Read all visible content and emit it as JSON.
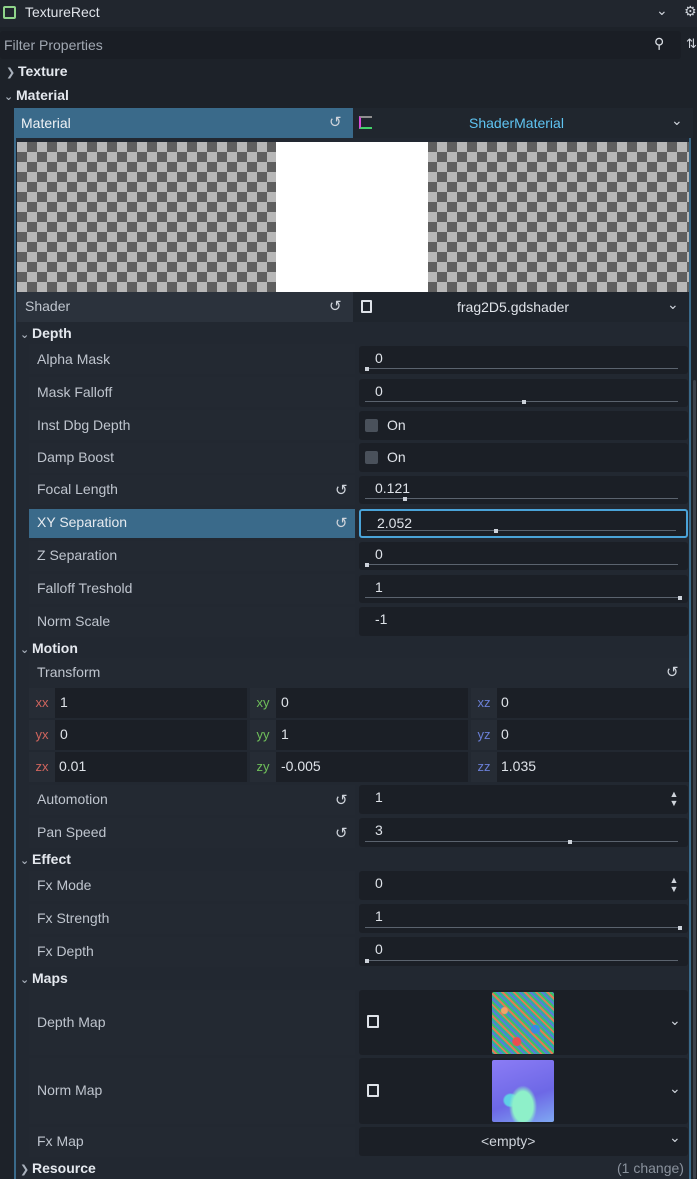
{
  "header": {
    "node_type": "TextureRect"
  },
  "filter": {
    "placeholder": "Filter Properties"
  },
  "sections": {
    "texture": "Texture",
    "material": "Material",
    "resource": "Resource",
    "resource_note": "(1 change)"
  },
  "material": {
    "label": "Material",
    "resource_type": "ShaderMaterial"
  },
  "shader": {
    "label": "Shader",
    "file": "frag2D5.gdshader"
  },
  "groups": {
    "depth": "Depth",
    "motion": "Motion",
    "effect": "Effect",
    "maps": "Maps"
  },
  "depth_props": [
    {
      "label": "Alpha Mask",
      "value": "0",
      "slider_fraction": 0.0
    },
    {
      "label": "Mask Falloff",
      "value": "0",
      "slider_fraction": 0.5
    },
    {
      "label": "Inst Dbg Depth",
      "check_label": "On"
    },
    {
      "label": "Damp Boost",
      "check_label": "On"
    },
    {
      "label": "Focal Length",
      "value": "0.121",
      "slider_fraction": 0.12
    },
    {
      "label": "XY Separation",
      "value": "2.052",
      "slider_fraction": 0.41
    },
    {
      "label": "Z Separation",
      "value": "0",
      "slider_fraction": 0.0
    },
    {
      "label": "Falloff Treshold",
      "value": "1",
      "slider_fraction": 1.0
    },
    {
      "label": "Norm Scale",
      "value": "-1"
    }
  ],
  "transform": {
    "label": "Transform",
    "cells": [
      {
        "axis": "xx",
        "value": "1"
      },
      {
        "axis": "xy",
        "value": "0"
      },
      {
        "axis": "xz",
        "value": "0"
      },
      {
        "axis": "yx",
        "value": "0"
      },
      {
        "axis": "yy",
        "value": "1"
      },
      {
        "axis": "yz",
        "value": "0"
      },
      {
        "axis": "zx",
        "value": "0.01"
      },
      {
        "axis": "zy",
        "value": "-0.005"
      },
      {
        "axis": "zz",
        "value": "1.035"
      }
    ]
  },
  "motion_props": [
    {
      "label": "Automotion",
      "value": "1"
    },
    {
      "label": "Pan Speed",
      "value": "3",
      "slider_fraction": 0.65
    }
  ],
  "effect_props": [
    {
      "label": "Fx Mode",
      "value": "0"
    },
    {
      "label": "Fx Strength",
      "value": "1",
      "slider_fraction": 1.0
    },
    {
      "label": "Fx Depth",
      "value": "0",
      "slider_fraction": 0.0
    }
  ],
  "maps": [
    {
      "label": "Depth Map"
    },
    {
      "label": "Norm Map"
    },
    {
      "label": "Fx Map",
      "value": "<empty>"
    }
  ],
  "colors": {
    "accent": "#3a6a8a",
    "accent_text": "#5fc4f2",
    "focus": "#4aa3d8",
    "x_axis": "#d0655e",
    "y_axis": "#6fbf5a",
    "z_axis": "#6a7fd6"
  }
}
